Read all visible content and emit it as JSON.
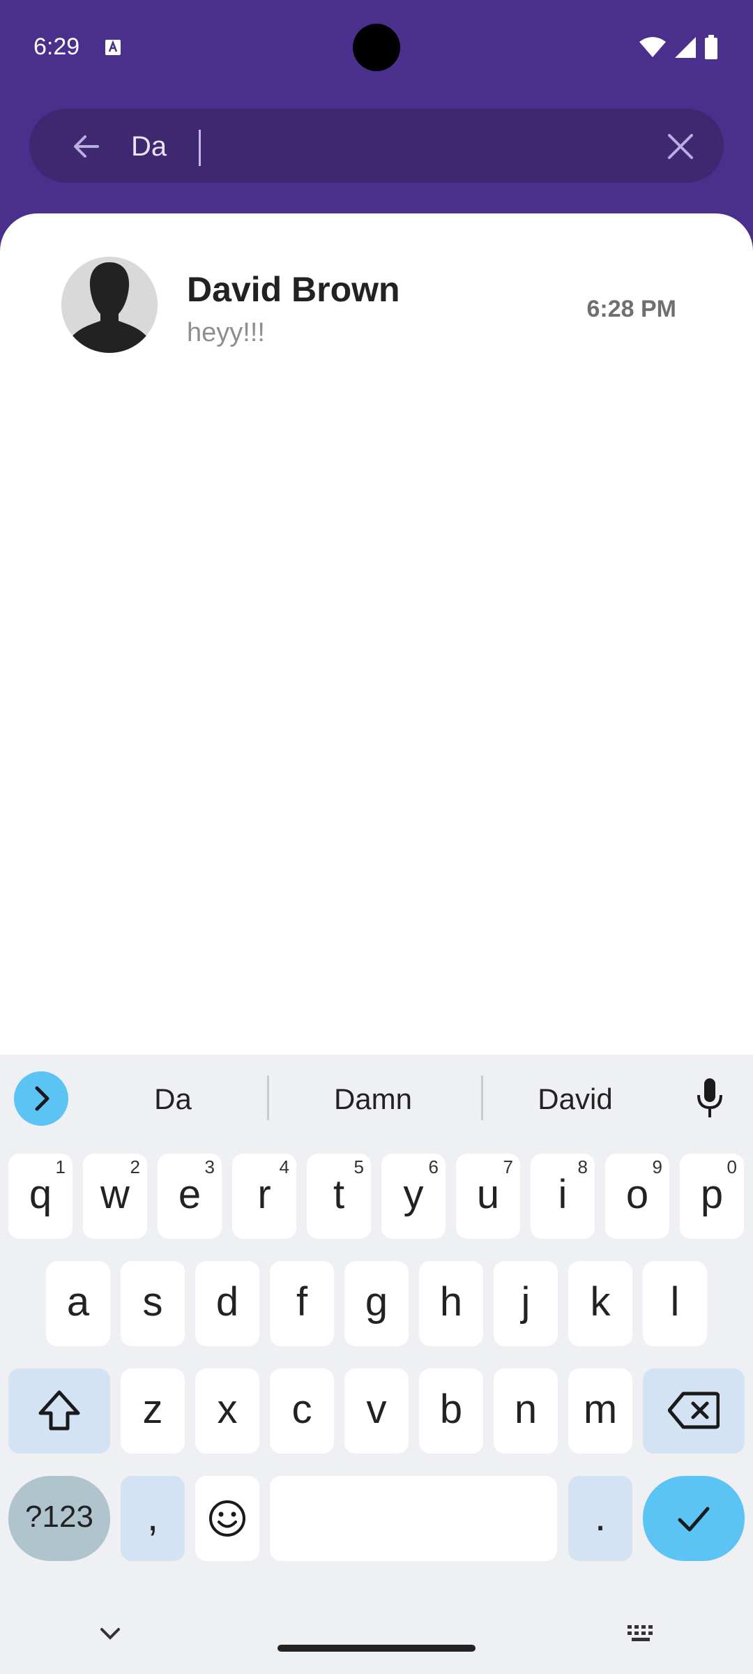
{
  "status_bar": {
    "time": "6:29"
  },
  "search": {
    "value": "Da",
    "placeholder": ""
  },
  "chat_results": [
    {
      "name": "David Brown",
      "preview": "heyy!!!",
      "time": "6:28 PM"
    }
  ],
  "keyboard": {
    "suggestions": [
      "Da",
      "Damn",
      "David"
    ],
    "row1": [
      {
        "key": "q",
        "hint": "1"
      },
      {
        "key": "w",
        "hint": "2"
      },
      {
        "key": "e",
        "hint": "3"
      },
      {
        "key": "r",
        "hint": "4"
      },
      {
        "key": "t",
        "hint": "5"
      },
      {
        "key": "y",
        "hint": "6"
      },
      {
        "key": "u",
        "hint": "7"
      },
      {
        "key": "i",
        "hint": "8"
      },
      {
        "key": "o",
        "hint": "9"
      },
      {
        "key": "p",
        "hint": "0"
      }
    ],
    "row2": [
      "a",
      "s",
      "d",
      "f",
      "g",
      "h",
      "j",
      "k",
      "l"
    ],
    "row3": [
      "z",
      "x",
      "c",
      "v",
      "b",
      "n",
      "m"
    ],
    "symbols_label": "?123",
    "comma_label": ",",
    "period_label": "."
  },
  "colors": {
    "header_bg": "#4a2f8c",
    "search_bg": "#3e2870",
    "accent": "#5cc4f5"
  }
}
